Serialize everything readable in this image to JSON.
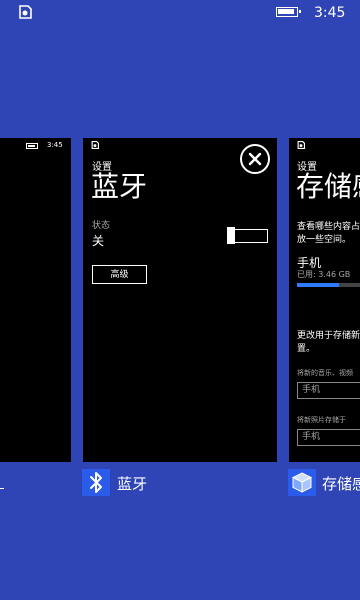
{
  "status_bar": {
    "time": "3:45"
  },
  "cards": [
    {
      "id": "left",
      "mini_time": "3:45"
    },
    {
      "id": "bluetooth",
      "settings_label": "设置",
      "title": "蓝牙",
      "state_label": "状态",
      "state_value": "关",
      "toggle_on": false,
      "advanced_label": "高级",
      "app_label": "蓝牙"
    },
    {
      "id": "storage",
      "settings_label": "设置",
      "title": "存储感",
      "desc_line1": "查看哪些内容占",
      "desc_line2": "放一些空间。",
      "phone_label": "手机",
      "used_label": "已用: 3.46 GB",
      "used_fraction": 0.52,
      "change_line1": "更改用于存储新",
      "change_line2": "置。",
      "music_label": "将新的音乐、视频",
      "music_select": "手机",
      "photo_label": "将新照片存储于",
      "photo_select": "手机",
      "app_label": "存储感"
    }
  ],
  "icons": {
    "status_app": "notification-icon",
    "close": "close-icon",
    "bluetooth": "bluetooth-icon",
    "storage": "storage-cube-icon"
  },
  "colors": {
    "background": "#2f45b6",
    "tile": "#2a5bea",
    "bar_fill": "#2f7bff"
  }
}
